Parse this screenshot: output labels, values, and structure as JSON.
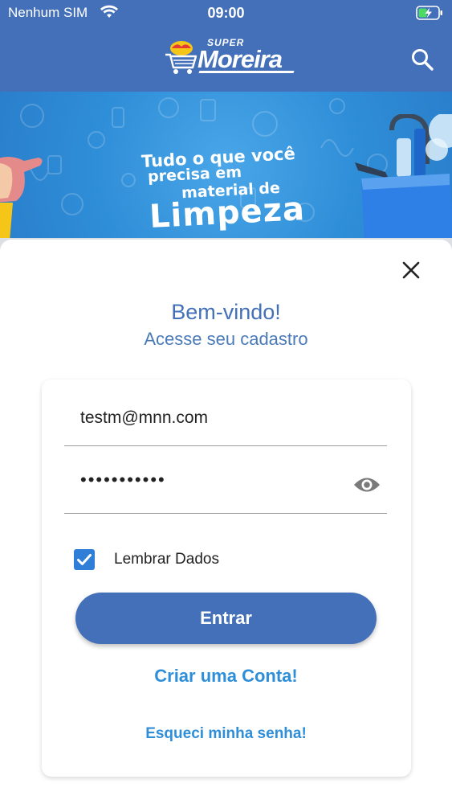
{
  "status_bar": {
    "carrier": "Nenhum SIM",
    "time": "09:00",
    "wifi_icon": "wifi-icon",
    "battery_icon": "battery-charging-icon"
  },
  "header": {
    "logo_small": "SUPER",
    "logo_name": "Moreira",
    "search_icon": "search-icon",
    "background": "#4370b8"
  },
  "banner": {
    "line1": "Tudo o que você",
    "line2": "precisa em",
    "line3": "material de",
    "line4": "Limpeza"
  },
  "login": {
    "close_icon": "close-icon",
    "title": "Bem-vindo!",
    "subtitle": "Acesse seu cadastro",
    "email_value": "testm@mnn.com",
    "password_value": "•••••••••••",
    "eye_icon": "eye-icon",
    "remember_label": "Lembrar Dados",
    "remember_checked": true,
    "submit_label": "Entrar",
    "create_account_label": "Criar uma Conta!",
    "forgot_password_label": "Esqueci minha senha!",
    "accent": "#2f7fd8",
    "primary": "#4370b8"
  }
}
